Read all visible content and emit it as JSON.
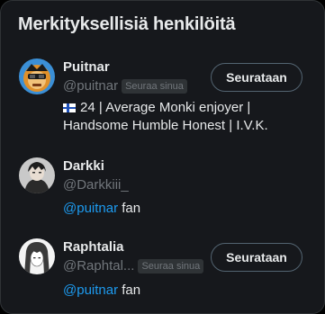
{
  "panel": {
    "title": "Merkityksellisiä henkilöitä"
  },
  "people": [
    {
      "name": "Puitnar",
      "handle": "@puitnar",
      "follows_you": "Seuraa sinua",
      "bio_flag": "finland-flag-icon",
      "bio_line1": "24 | Average Monki enjoyer |",
      "bio_line2": "Handsome Humble Honest | I.V.K.",
      "button": "Seurataan"
    },
    {
      "name": "Darkki",
      "handle": "@Darkkiii_",
      "bio_mention": "@puitnar",
      "bio_rest": " fan"
    },
    {
      "name": "Raphtalia",
      "handle": "@Raphtal...",
      "follows_you": "Seuraa sinua",
      "bio_mention": "@puitnar",
      "bio_rest": " fan",
      "button": "Seurataan"
    }
  ],
  "colors": {
    "background": "#16181c",
    "text": "#e7e9ea",
    "muted": "#71767b",
    "link": "#1d9bf0",
    "border": "#2f3336"
  }
}
